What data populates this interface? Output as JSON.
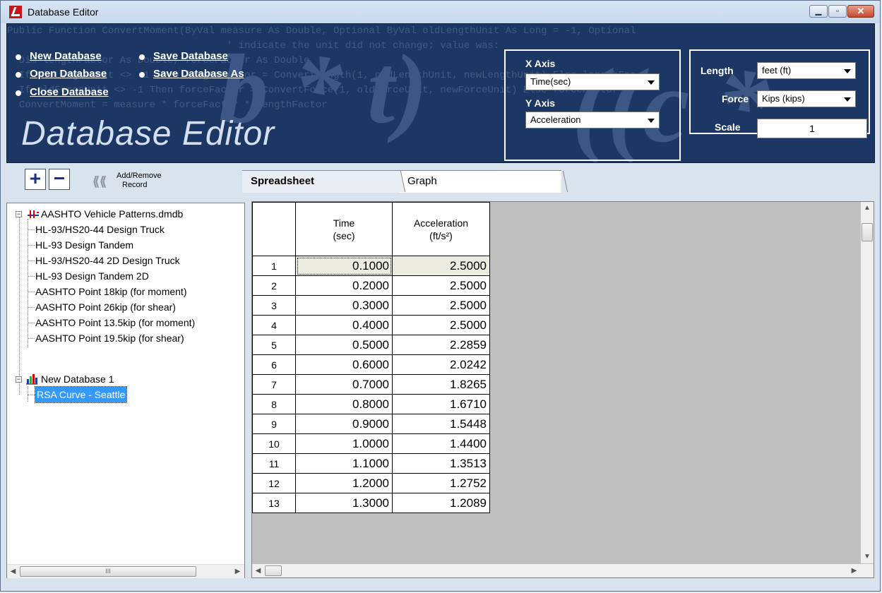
{
  "window": {
    "title": "Database Editor",
    "min_icon": "minimize-icon",
    "max_icon": "maximize-icon",
    "close_icon": "close-icon"
  },
  "banner": {
    "title": "Database Editor",
    "bg_code": [
      "Public Function ConvertMoment(ByVal measure As Double, Optional ByVal oldLengthUnit As Long = -1, Optional",
      "                                     ' indicate the unit did not change; value was:",
      "  Dim lengthFactor As Double, forceFactor As Double",
      "  If oldLengthUnit <> -1 Then lengthFactor = ConvertLength(1, oldLengthUnit, newLengthUnit) Else lengthFac",
      "  If oldForceUnit <> -1 Then forceFactor = ConvertForce(1, oldForceUnit, newForceUnit) Else forceFactor",
      "  ConvertMoment = measure * forceFactor * lengthFactor"
    ],
    "deco_left": "b * t)",
    "deco_right": "((c * (g"
  },
  "menu": {
    "new_db": "New Database",
    "open_db": "Open Database",
    "close_db": "Close Database",
    "save_db": "Save Database",
    "save_db_as": "Save Database As"
  },
  "axes": {
    "x_label": "X Axis",
    "x_value": "Time(sec)",
    "y_label": "Y Axis",
    "y_value": "Acceleration"
  },
  "units": {
    "length_label": "Length",
    "length_value": "feet (ft)",
    "force_label": "Force",
    "force_value": "Kips (kips)",
    "scale_label": "Scale",
    "scale_value": "1"
  },
  "toolbar": {
    "add": "+",
    "remove": "−",
    "add_remove_line1": "Add/Remove",
    "add_remove_line2": "Record"
  },
  "tree": {
    "root1": "AASHTO Vehicle Patterns.dmdb",
    "root1_items": [
      "HL-93/HS20-44 Design Truck",
      "HL-93 Design Tandem",
      "HL-93/HS20-44 2D Design Truck",
      "HL-93 Design Tandem 2D",
      "AASHTO Point 18kip (for moment)",
      "AASHTO Point 26kip (for shear)",
      "AASHTO Point 13.5kip (for moment)",
      "AASHTO Point 19.5kip (for shear)"
    ],
    "root2": "New Database 1",
    "root2_items": [
      "RSA Curve - Seattle"
    ]
  },
  "tabs": {
    "spreadsheet": "Spreadsheet",
    "graph": "Graph"
  },
  "grid": {
    "col1_line1": "Time",
    "col1_line2": "(sec)",
    "col2_line1": "Acceleration",
    "col2_line2": "(ft/s²)",
    "rows": [
      {
        "n": "1",
        "t": "0.1000",
        "a": "2.5000"
      },
      {
        "n": "2",
        "t": "0.2000",
        "a": "2.5000"
      },
      {
        "n": "3",
        "t": "0.3000",
        "a": "2.5000"
      },
      {
        "n": "4",
        "t": "0.4000",
        "a": "2.5000"
      },
      {
        "n": "5",
        "t": "0.5000",
        "a": "2.2859"
      },
      {
        "n": "6",
        "t": "0.6000",
        "a": "2.0242"
      },
      {
        "n": "7",
        "t": "0.7000",
        "a": "1.8265"
      },
      {
        "n": "8",
        "t": "0.8000",
        "a": "1.6710"
      },
      {
        "n": "9",
        "t": "0.9000",
        "a": "1.5448"
      },
      {
        "n": "10",
        "t": "1.0000",
        "a": "1.4400"
      },
      {
        "n": "11",
        "t": "1.1000",
        "a": "1.3513"
      },
      {
        "n": "12",
        "t": "1.2000",
        "a": "1.2752"
      },
      {
        "n": "13",
        "t": "1.3000",
        "a": "1.2089"
      }
    ]
  },
  "scroll": {
    "grip": "III"
  }
}
